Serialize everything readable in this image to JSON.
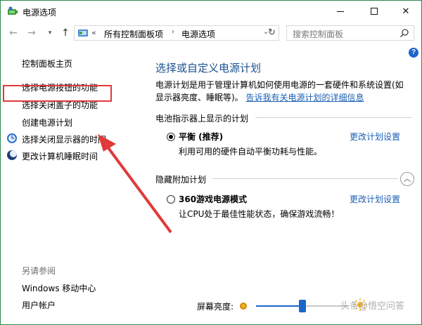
{
  "window": {
    "title": "电源选项"
  },
  "address": {
    "chevrons": "«",
    "crumbs": [
      "所有控制面板项",
      "电源选项"
    ],
    "separator": "›"
  },
  "search": {
    "placeholder": "搜索控制面板"
  },
  "leftnav": {
    "home": "控制面板主页",
    "items": [
      "选择电源按钮的功能",
      "选择关闭盖子的功能",
      "创建电源计划",
      "选择关闭显示器的时间",
      "更改计算机睡眠时间"
    ],
    "see_also_title": "另请参阅",
    "see_also": [
      "Windows 移动中心",
      "用户帐户"
    ]
  },
  "main": {
    "title": "选择或自定义电源计划",
    "desc_text": "电源计划是用于管理计算机如何使用电源的一套硬件和系统设置(如显示器亮度、睡眠等)。",
    "desc_link": "告诉我有关电源计划的详细信息",
    "group1_header": "电池指示器上显示的计划",
    "group2_header": "隐藏附加计划",
    "plans": [
      {
        "name": "平衡 (推荐)",
        "desc": "利用可用的硬件自动平衡功耗与性能。",
        "change": "更改计划设置",
        "selected": true
      },
      {
        "name": "360游戏电源模式",
        "desc": "让CPU处于最佳性能状态，确保游戏流畅！",
        "change": "更改计划设置",
        "selected": false
      }
    ]
  },
  "brightness": {
    "label": "屏幕亮度:",
    "level": 0.5
  },
  "watermark": "头条@悟空问答",
  "colors": {
    "link": "#1a5fb4",
    "title": "#1a4f8f",
    "accent": "#1b66c9",
    "annotation": "#e03a3a"
  }
}
